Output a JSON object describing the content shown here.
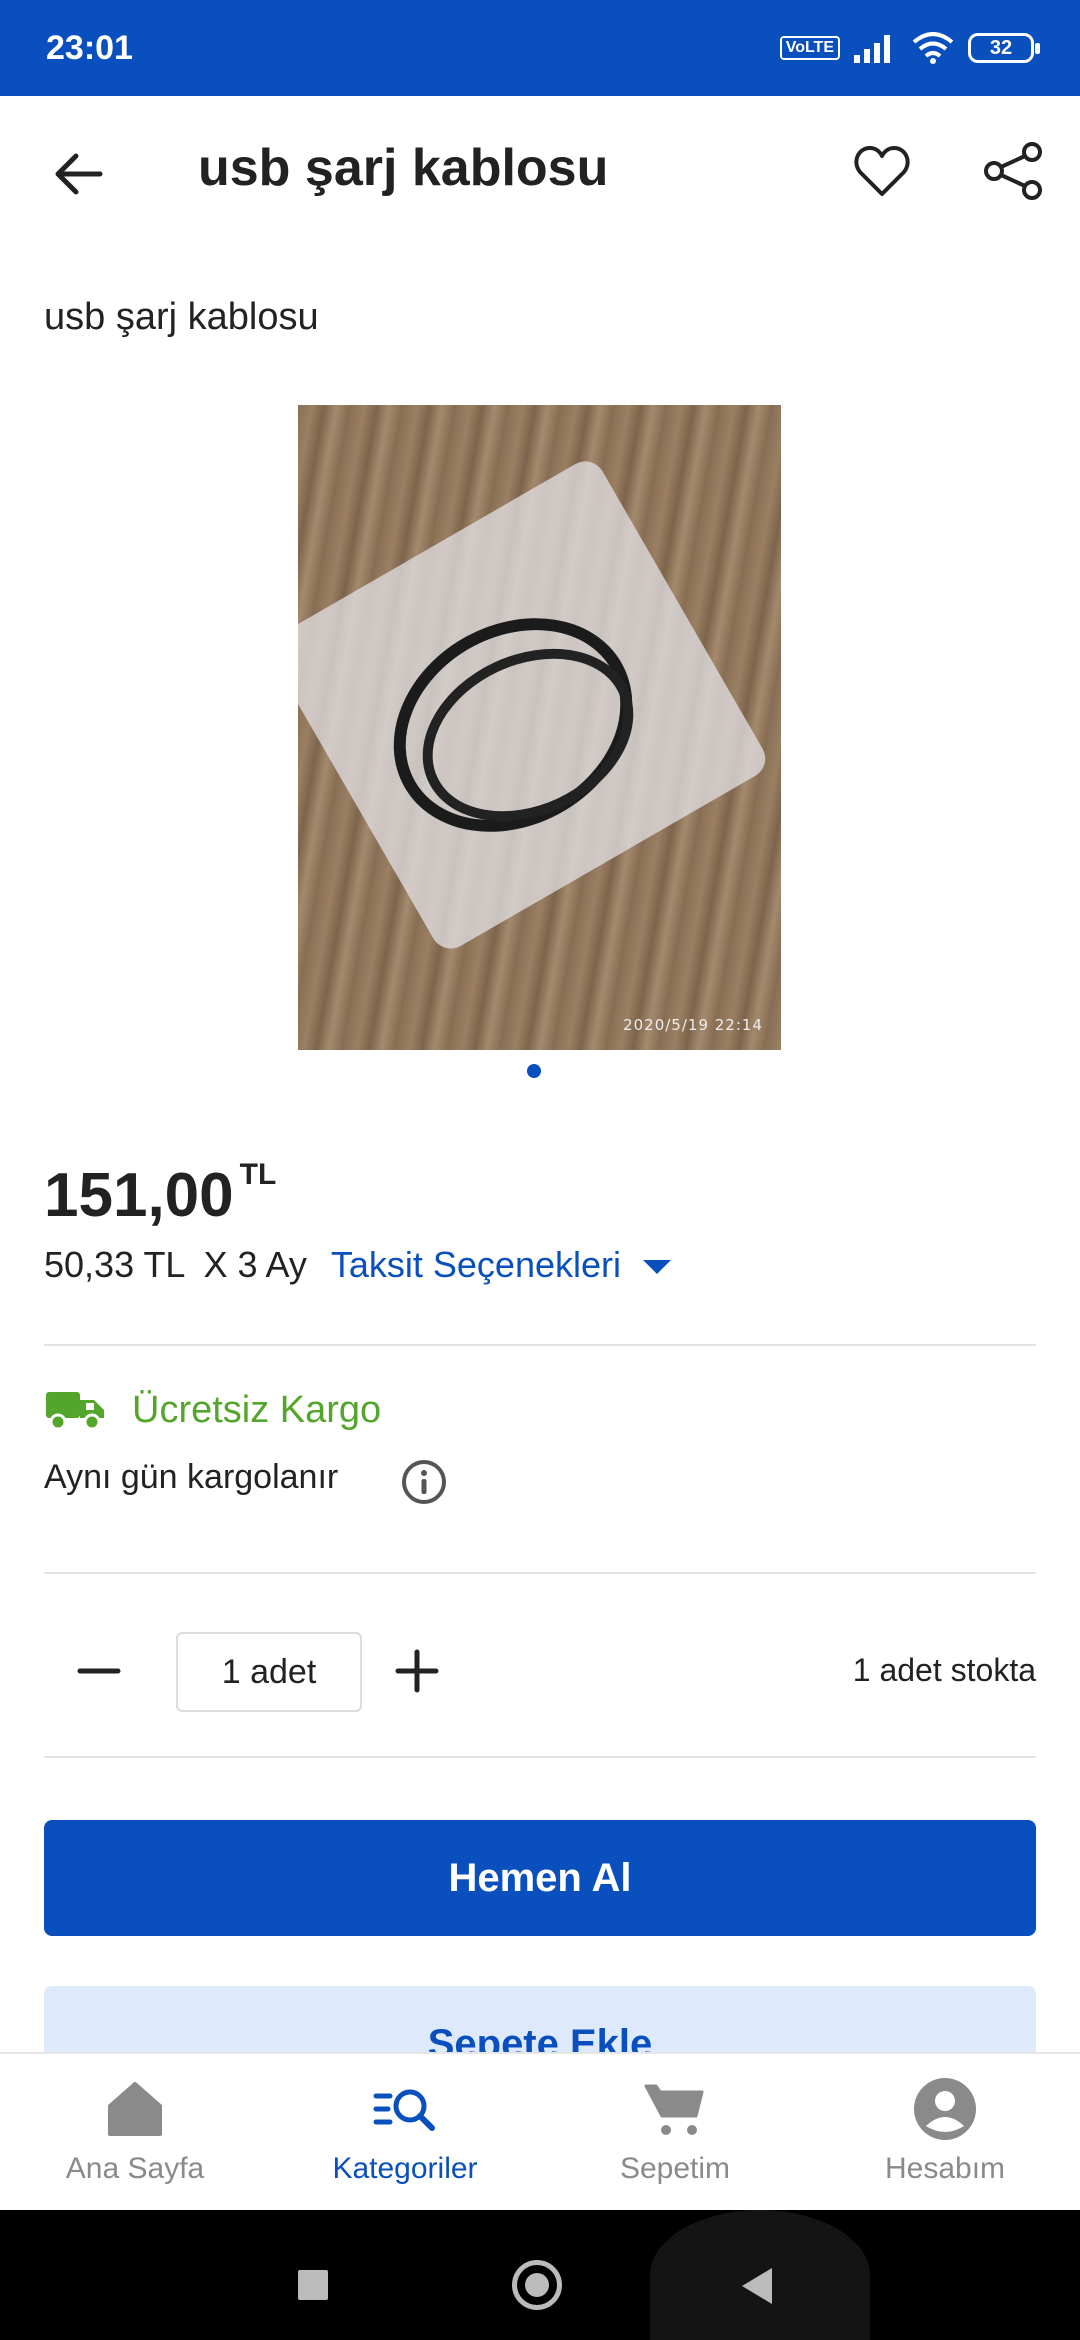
{
  "status_bar": {
    "time": "23:01",
    "network": "VoLTE",
    "battery": "32"
  },
  "header": {
    "title": "usb şarj kablosu"
  },
  "product": {
    "name": "usb şarj kablosu",
    "image_timestamp": "2020/5/19  22:14",
    "price": "151,00",
    "currency": "TL",
    "installment_amount": "50,33 TL",
    "installment_months": "X 3 Ay",
    "installment_link": "Taksit Seçenekleri"
  },
  "shipping": {
    "free_label": "Ücretsiz Kargo",
    "same_day": "Aynı gün kargolanır"
  },
  "quantity": {
    "value": "1 adet",
    "stock": "1 adet stokta"
  },
  "actions": {
    "buy_now": "Hemen Al",
    "add_to_cart": "Sepete Ekle"
  },
  "nav": {
    "items": [
      {
        "label": "Ana Sayfa",
        "icon": "home-icon"
      },
      {
        "label": "Kategoriler",
        "icon": "categories-search-icon"
      },
      {
        "label": "Sepetim",
        "icon": "cart-icon"
      },
      {
        "label": "Hesabım",
        "icon": "account-icon"
      }
    ]
  },
  "colors": {
    "brand": "#0a4fbe",
    "cargo_green": "#53a62b",
    "add_to_cart_bg": "#deeafb"
  }
}
